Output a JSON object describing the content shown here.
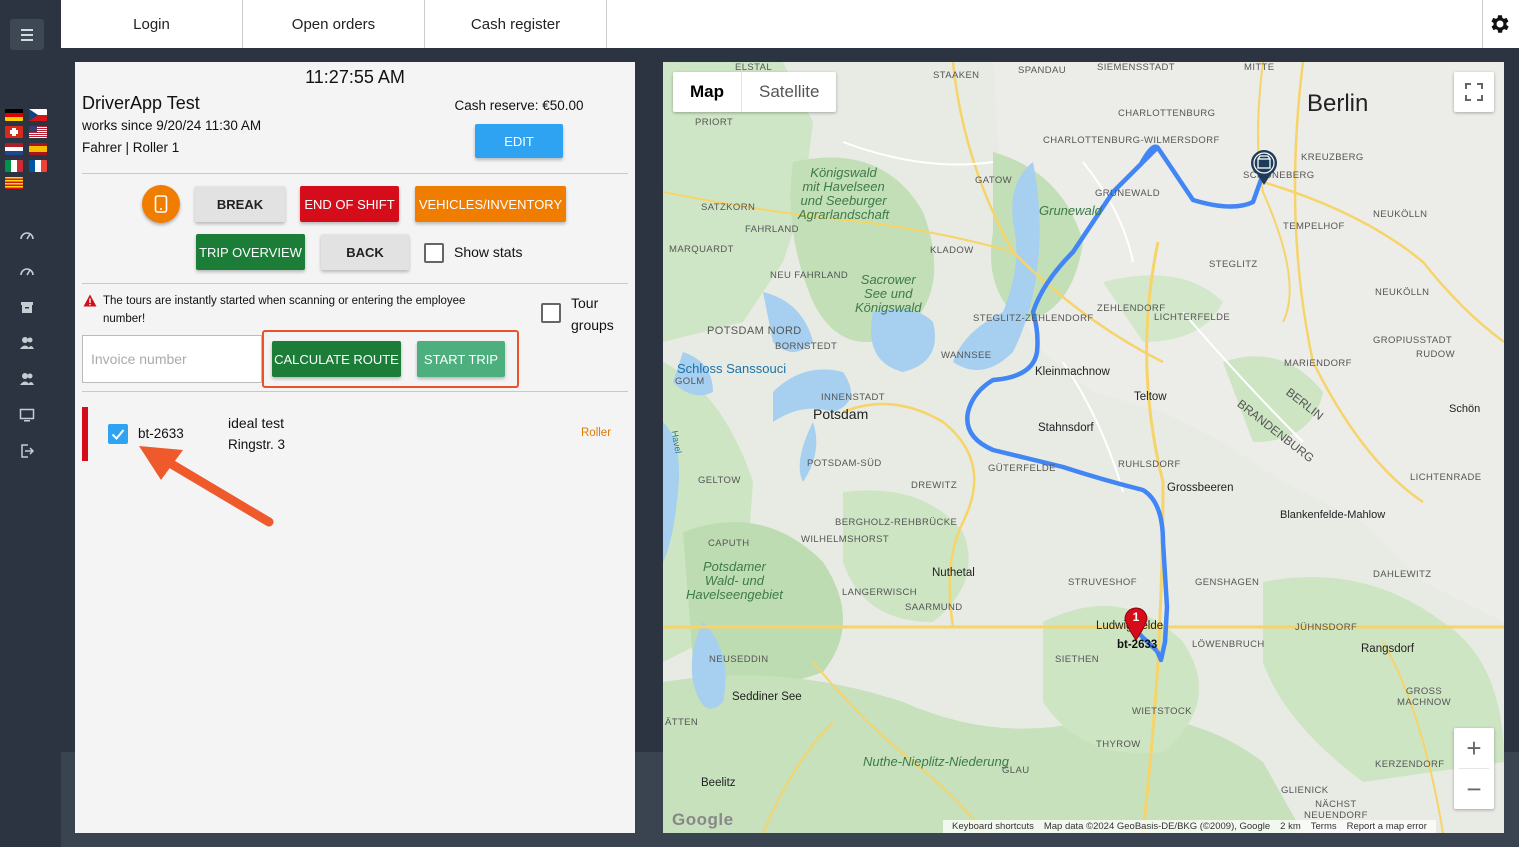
{
  "nav": {
    "tabs": [
      "Login",
      "Open orders",
      "Cash register"
    ]
  },
  "panel": {
    "clock": "11:27:55 AM",
    "driver_name": "DriverApp Test",
    "works_since": "works since 9/20/24 11:30 AM",
    "role": "Fahrer | Roller 1",
    "cash_reserve": "Cash reserve: €50.00",
    "buttons": {
      "edit": "EDIT",
      "break": "BREAK",
      "end_of_shift": "END OF SHIFT",
      "vehicles": "VEHICLES/INVENTORY",
      "trip_overview": "TRIP OVERVIEW",
      "back": "BACK",
      "calculate_route": "CALCULATE ROUTE",
      "start_trip": "START TRIP"
    },
    "show_stats": "Show stats",
    "warning": "The tours are instantly started when scanning or entering the employee number!",
    "tour_groups": "Tour groups",
    "invoice_placeholder": "Invoice number",
    "order": {
      "id": "bt-2633",
      "name": "ideal test",
      "street": "Ringstr. 3",
      "vehicle": "Roller"
    }
  },
  "map": {
    "toggle": [
      "Map",
      "Satellite"
    ],
    "zoom_in": "+",
    "zoom_out": "−",
    "marker_number": "1",
    "marker_label": "bt-2633",
    "google": "Google",
    "footer": [
      "Keyboard shortcuts",
      "Map data ©2024 GeoBasis-DE/BKG (©2009), Google",
      "2 km",
      "Terms",
      "Report a map error"
    ],
    "labels": {
      "berlin": "Berlin",
      "potsdam": "Potsdam",
      "innenstadt": "INNENSTADT",
      "potsdam_nord": "POTSDAM NORD",
      "sanssouci": "Schloss Sanssouci",
      "koenigswald": "Königswald\nmit Havelseen\nund Seeburger\nAgrarlandschaft",
      "sacrower": "Sacrower\nSee und\nKönigswald",
      "grunewald_forest": "Grunewald",
      "potsdamer_wald": "Potsdamer\nWald- und\nHavelseengebiet",
      "nuthe": "Nuthe-Nieplitz-Niederung",
      "kleinmachnow": "Kleinmachnow",
      "teltow": "Teltow",
      "stahnsdorf": "Stahnsdorf",
      "grossbeeren": "Grossbeeren",
      "nuthetal": "Nuthetal",
      "ludwigsfelde": "Ludwigsfelde",
      "seddiner": "Seddiner See",
      "beelitz": "Beelitz",
      "rangsdorf": "Rangsdorf",
      "blankenfelde": "Blankenfelde-Mahlow",
      "berlin_state": "BERLIN",
      "brandenburg_state": "BRANDENBURG",
      "spandau": "SPANDAU",
      "siemensstadt": "SIEMENSSTADT",
      "mitte": "MITTE",
      "charlottenburg": "CHARLOTTENBURG",
      "charlottenburg_w": "CHARLOTTENBURG-WILMERSDORF",
      "kreuzberg": "KREUZBERG",
      "schoeneberg": "SCHÖNEBERG",
      "grunewald": "GRUNEWALD",
      "tempelhof": "TEMPELHOF",
      "neukoelln": "NEUKÖLLN",
      "steglitz": "STEGLITZ",
      "steglitz_z": "STEGLITZ-ZEHLENDORF",
      "zehlendorf": "ZEHLENDORF",
      "lichterfelde": "LICHTERFELDE",
      "mariendorf": "MARIENDORF",
      "gropiusstadt": "GROPIUSSTADT",
      "rudow": "RUDOW",
      "wannsee": "WANNSEE",
      "kladow": "KLADOW",
      "gatow": "GATOW",
      "staaken": "STAAKEN",
      "priort": "PRIORT",
      "satzkorn": "SATZKORN",
      "fahrland": "FAHRLAND",
      "marquardt": "MARQUARDT",
      "neu_fahrland": "NEU FAHRLAND",
      "bornstedt": "BORNSTEDT",
      "golm": "GOLM",
      "potsdam_sued": "POTSDAM-SÜD",
      "geltow": "GELTOW",
      "drewitz": "DREWITZ",
      "gueterfelde": "GÜTERFELDE",
      "ruhlsdorf": "RUHLSDORF",
      "bergholz": "BERGHOLZ-REHBRÜCKE",
      "wilhelmshorst": "WILHELMSHORST",
      "caputh": "CAPUTH",
      "langerwisch": "LANGERWISCH",
      "saarmund": "SAARMUND",
      "struveshof": "STRUVESHOF",
      "genshagen": "GENSHAGEN",
      "dahlewitz": "DAHLEWITZ",
      "juehnsdorf": "JÜHNSDORF",
      "loewenbruch": "LÖWENBRUCH",
      "siethen": "SIETHEN",
      "neuseddin": "NEUSEDDIN",
      "wietstock": "WIETSTOCK",
      "thyrow": "THYROW",
      "glau": "GLAU",
      "gross_machnow": "GROSS\nMACHNOW",
      "kerzendorf": "KERZENDORF",
      "glienick": "GLIENICK",
      "naechst": "NÄCHST\nNEUENDORF",
      "lichtenrade": "LICHTENRADE",
      "elstal": "ELSTAL",
      "baetten": "ÄTTEN",
      "schoen": "Schön",
      "havel": "Havel"
    }
  }
}
